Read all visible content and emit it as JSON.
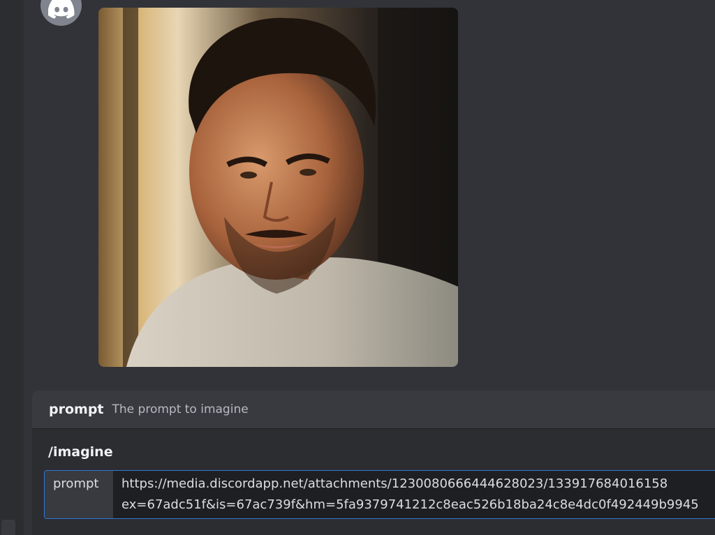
{
  "attachment": {
    "icon": "portrait-photo"
  },
  "author": {
    "avatar_icon": "discord-logo-icon"
  },
  "command_popup": {
    "option_header": {
      "name": "prompt",
      "description": "The prompt to imagine"
    },
    "command": "/imagine",
    "option_field": {
      "label": "prompt",
      "value_line1": "https://media.discordapp.net/attachments/1230080666444628023/133917684016158",
      "value_line2": "ex=67adc51f&is=67ac739f&hm=5fa9379741212c8eac526b18ba24c8e4dc0f492449b9945"
    }
  },
  "colors": {
    "background": "#313338",
    "popup_background": "#2b2d31",
    "header_background": "#383a40",
    "focus_border": "#2f78d6",
    "text_primary": "#f2f3f5",
    "text_secondary": "#b5bac1"
  }
}
